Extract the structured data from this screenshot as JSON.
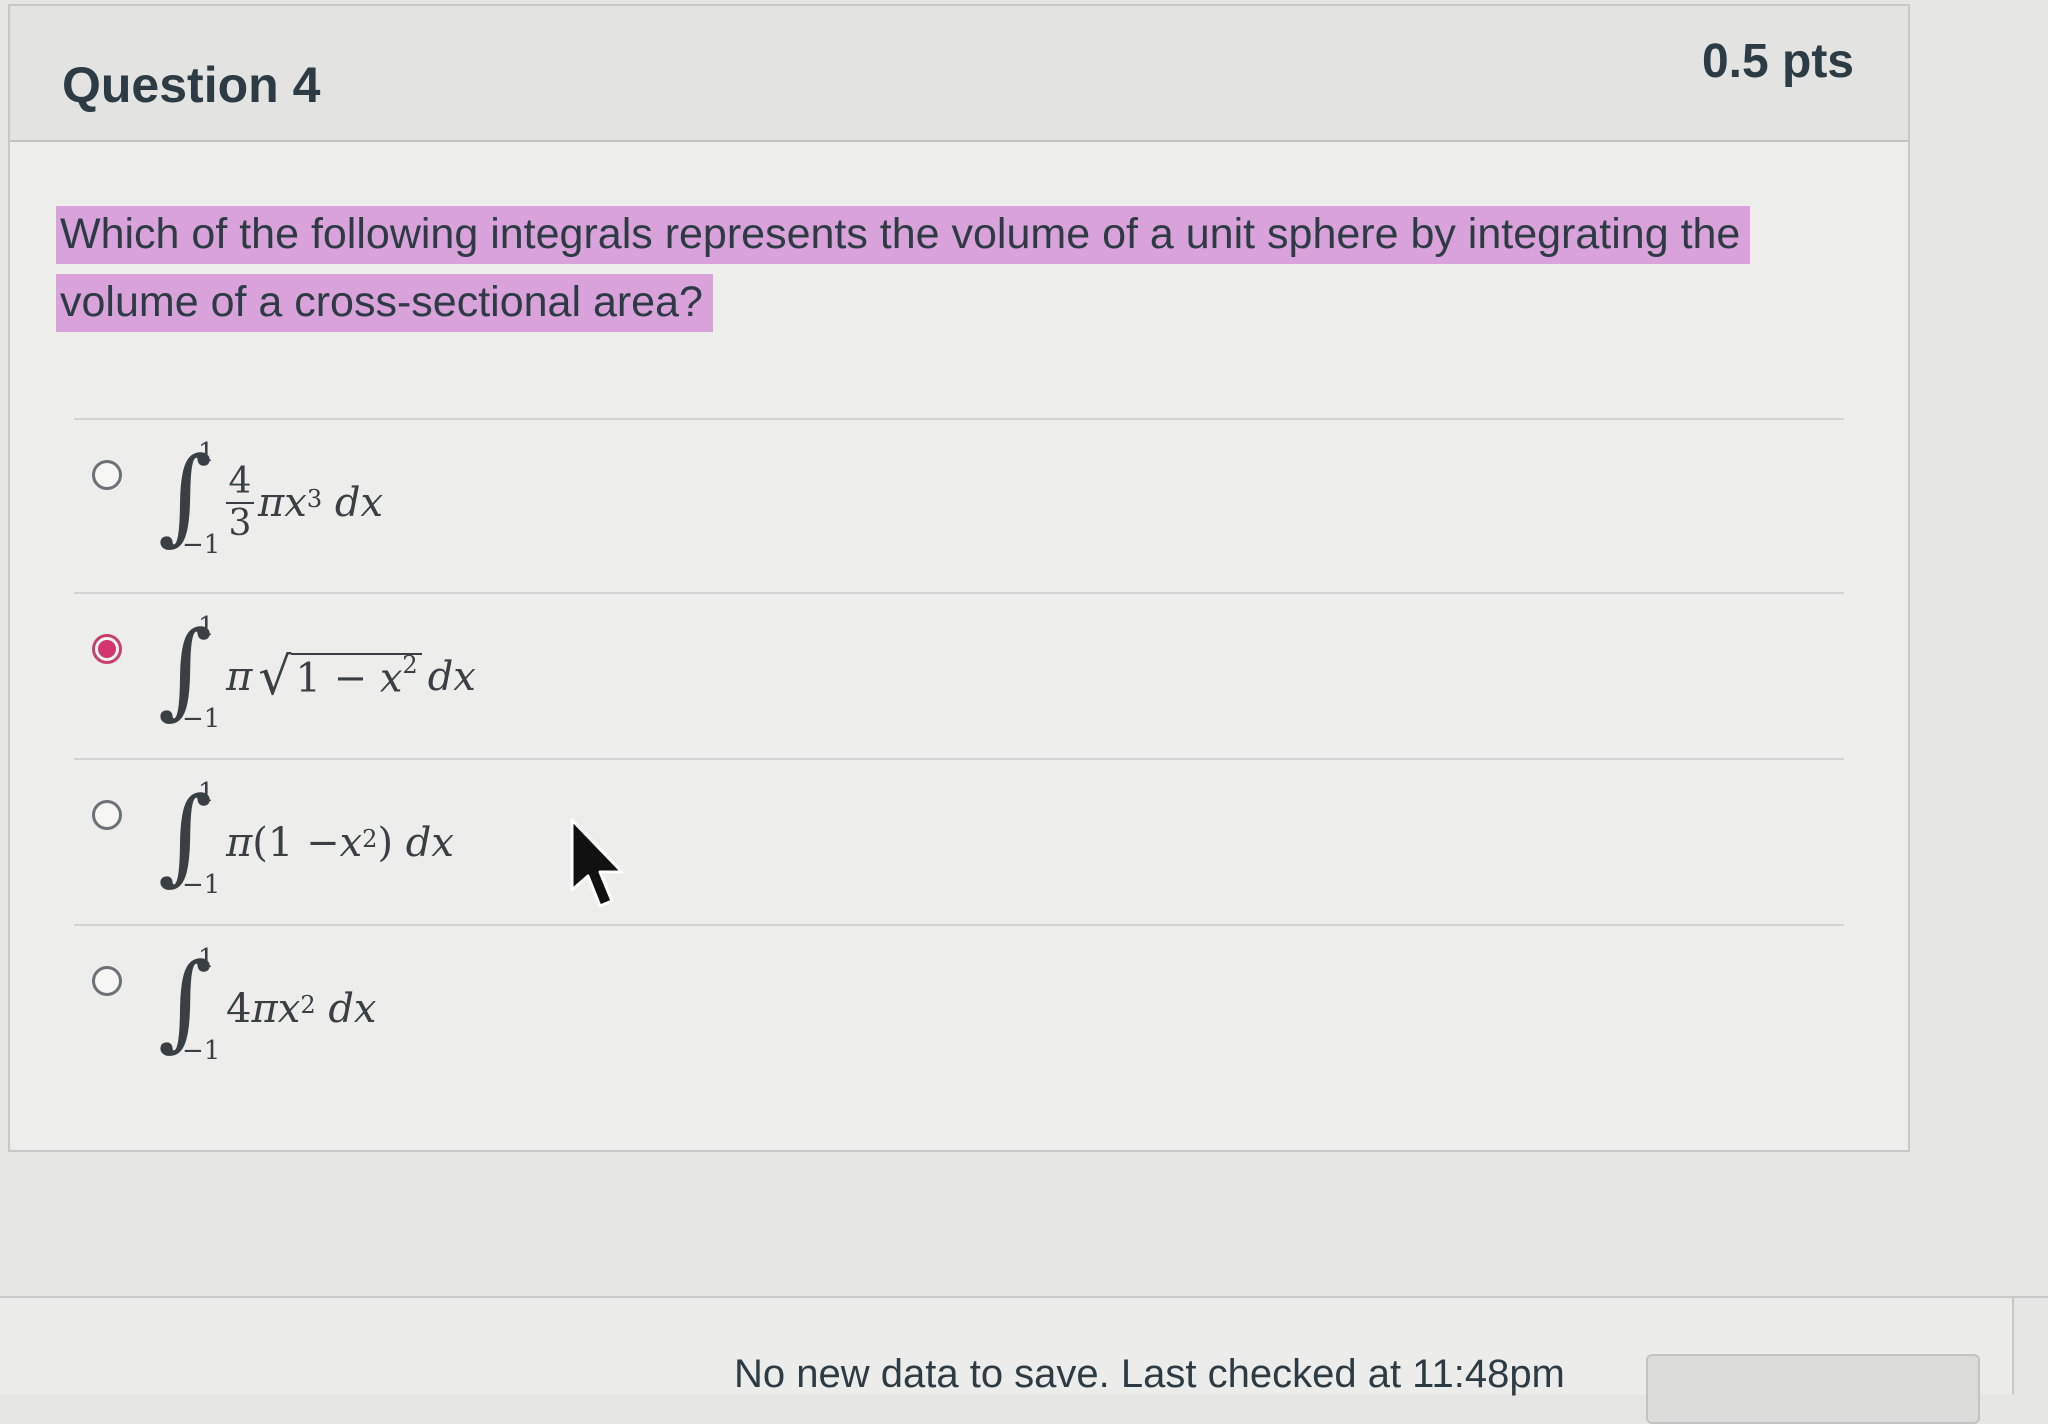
{
  "question": {
    "title": "Question 4",
    "points": "0.5 pts",
    "text": "Which of the following integrals represents the volume of a unit sphere by integrating the volume of a cross-sectional area?"
  },
  "answers": [
    {
      "selected": false,
      "lower": "−1",
      "upper": "1",
      "parts": {
        "num": "4",
        "den": "3",
        "pi": "π",
        "var": "x",
        "exp": "3",
        "dx": "dx"
      }
    },
    {
      "selected": true,
      "lower": "−1",
      "upper": "1",
      "parts": {
        "pi": "π",
        "radicand_a": "1 − ",
        "var": "x",
        "exp": "2",
        "dx": "dx"
      }
    },
    {
      "selected": false,
      "lower": "−1",
      "upper": "1",
      "parts": {
        "pi": "π",
        "open": "(1 − ",
        "var": "x",
        "exp": "2",
        "close": ")",
        "dx": "dx"
      }
    },
    {
      "selected": false,
      "lower": "−1",
      "upper": "1",
      "parts": {
        "coef": "4",
        "pi": "π",
        "var": "x",
        "exp": "2",
        "dx": "dx"
      }
    }
  ],
  "footer": {
    "status": "No new data to save. Last checked at 11:48pm"
  },
  "colors": {
    "highlight": "#d9a2da",
    "radio_selected": "#d4356d",
    "text": "#2d3b45"
  },
  "icons": {
    "cursor": "mouse-pointer-icon",
    "radio": "radio-button-icon",
    "integral": "integral-sign-icon"
  }
}
